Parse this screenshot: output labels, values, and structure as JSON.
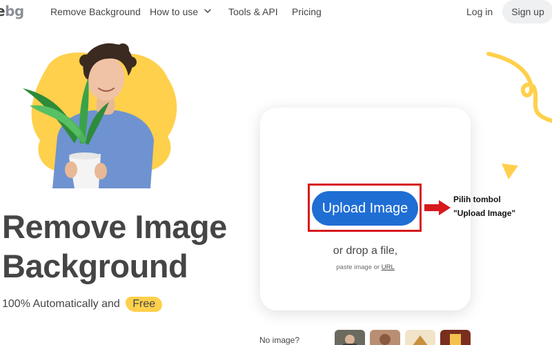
{
  "header": {
    "logo_part1": "e",
    "logo_part2": "bg",
    "nav": {
      "remove_background": "Remove Background",
      "how_to_use": "How to use",
      "tools_api": "Tools & API",
      "pricing": "Pricing"
    },
    "login": "Log in",
    "signup": "Sign up"
  },
  "hero": {
    "title_line1": "Remove Image",
    "title_line2": "Background",
    "subtitle": "100% Automatically and",
    "badge": "Free"
  },
  "upload": {
    "button_label": "Upload Image",
    "drop_text": "or drop a file,",
    "paste_text": "paste image or",
    "url_link": "URL"
  },
  "annotation": {
    "line1": "Pilih tombol",
    "line2": "\"Upload Image\""
  },
  "samples": {
    "label": "No image?"
  },
  "colors": {
    "accent_blue": "#1f6ed4",
    "highlight_yellow": "#ffd04b",
    "annotation_red": "#d7191c"
  }
}
